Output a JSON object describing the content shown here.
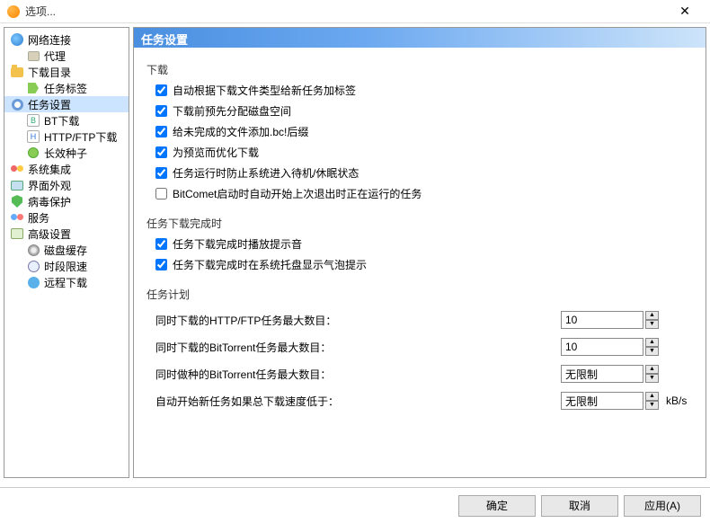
{
  "window": {
    "title": "选项..."
  },
  "sidebar": {
    "items": [
      {
        "label": "网络连接"
      },
      {
        "label": "代理"
      },
      {
        "label": "下载目录"
      },
      {
        "label": "任务标签"
      },
      {
        "label": "任务设置"
      },
      {
        "label": "BT下载"
      },
      {
        "label": "HTTP/FTP下载"
      },
      {
        "label": "长效种子"
      },
      {
        "label": "系统集成"
      },
      {
        "label": "界面外观"
      },
      {
        "label": "病毒保护"
      },
      {
        "label": "服务"
      },
      {
        "label": "高级设置"
      },
      {
        "label": "磁盘缓存"
      },
      {
        "label": "时段限速"
      },
      {
        "label": "远程下载"
      }
    ]
  },
  "panel": {
    "title": "任务设置",
    "group_download": "下载",
    "chk1": "自动根据下载文件类型给新任务加标签",
    "chk2": "下载前预先分配磁盘空间",
    "chk3": "给未完成的文件添加.bc!后缀",
    "chk4": "为预览而优化下载",
    "chk5": "任务运行时防止系统进入待机/休眠状态",
    "chk6": "BitComet启动时自动开始上次退出时正在运行的任务",
    "group_complete": "任务下载完成时",
    "chk7": "任务下载完成时播放提示音",
    "chk8": "任务下载完成时在系统托盘显示气泡提示",
    "group_plan": "任务计划",
    "plan1_label": "同时下载的HTTP/FTP任务最大数目：",
    "plan1_value": "10",
    "plan2_label": "同时下载的BitTorrent任务最大数目：",
    "plan2_value": "10",
    "plan3_label": "同时做种的BitTorrent任务最大数目：",
    "plan3_value": "无限制",
    "plan4_label": "自动开始新任务如果总下载速度低于：",
    "plan4_value": "无限制",
    "plan4_unit": "kB/s"
  },
  "footer": {
    "ok": "确定",
    "cancel": "取消",
    "apply": "应用(A)"
  }
}
